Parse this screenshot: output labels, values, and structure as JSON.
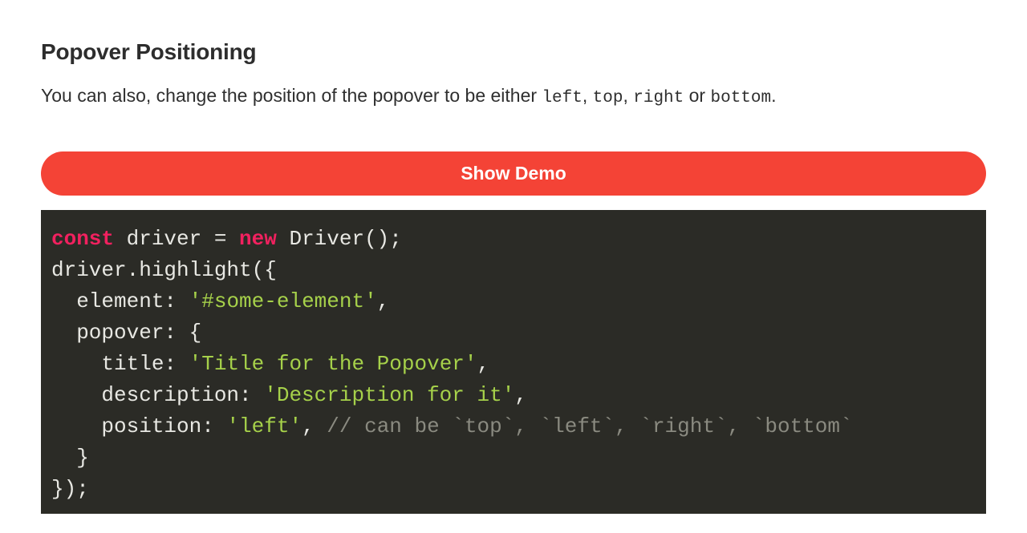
{
  "section": {
    "title": "Popover Positioning",
    "description": {
      "part1": "You can also, change the position of the popover to be either ",
      "code1": "left",
      "sep1": ", ",
      "code2": "top",
      "sep2": ", ",
      "code3": "right",
      "sep3": " or ",
      "code4": "bottom",
      "part2": "."
    }
  },
  "button": {
    "label": "Show Demo",
    "background": "#f44336",
    "text_color": "#ffffff"
  },
  "code": {
    "language": "javascript",
    "background": "#2b2b26",
    "colors": {
      "keyword": "#f1215f",
      "string": "#a6d14a",
      "comment": "#8a8a80",
      "plain": "#e8e8e3"
    },
    "lines": {
      "l1_kw_const": "const",
      "l1_rest": " driver = ",
      "l1_kw_new": "new",
      "l1_tail": " Driver();",
      "l2": "driver.highlight({",
      "l3_key": "  element: ",
      "l3_str": "'#some-element'",
      "l3_tail": ",",
      "l4": "  popover: {",
      "l5_key": "    title: ",
      "l5_str": "'Title for the Popover'",
      "l5_tail": ",",
      "l6_key": "    description: ",
      "l6_str": "'Description for it'",
      "l6_tail": ",",
      "l7_key": "    position: ",
      "l7_str": "'left'",
      "l7_tail": ", ",
      "l7_comment": "// can be `top`, `left`, `right`, `bottom`",
      "l8": "  }",
      "l9": "});"
    }
  }
}
